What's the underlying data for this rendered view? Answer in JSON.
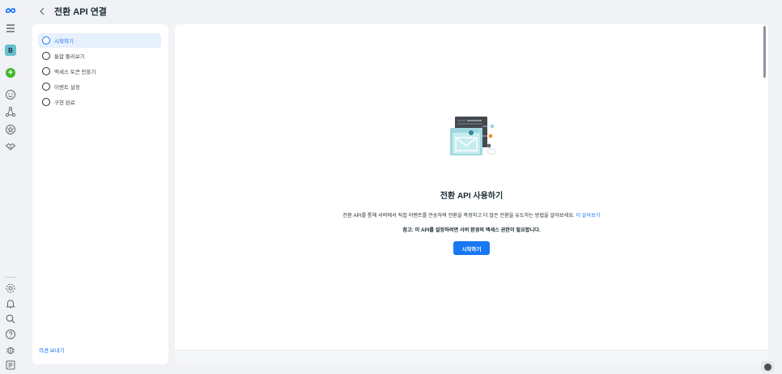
{
  "header": {
    "title": "전환 API 연결",
    "back_icon": "chevron-left-icon"
  },
  "rail": {
    "avatar_letter": "B",
    "icons": [
      "meta-logo-icon",
      "menu-icon",
      "create-plus-icon",
      "smiley-icon",
      "nodes-icon",
      "star-badge-icon",
      "handshake-icon",
      "settings-icon",
      "bell-icon",
      "search-icon",
      "help-icon",
      "bug-icon",
      "grid-icon"
    ]
  },
  "steps": {
    "items": [
      {
        "label": "시작하기",
        "active": true
      },
      {
        "label": "통합 둘러보기",
        "active": false
      },
      {
        "label": "액세스 토큰 만들기",
        "active": false
      },
      {
        "label": "이벤트 설정",
        "active": false
      },
      {
        "label": "구현 완료",
        "active": false
      }
    ],
    "feedback_label": "의견 보내기"
  },
  "main": {
    "heading": "전환 API 사용하기",
    "description": "전환 API를 통해 서버에서 직접 이벤트를 전송하여 전환을 측정하고 더 많은 전환을 유도하는 방법을 알아보세요.",
    "learn_more": "더 알아보기",
    "note": "참고: 이 API를 설정하려면 서버 환경의 액세스 권한이 필요합니다.",
    "start_button": "시작하기"
  },
  "colors": {
    "accent": "#1877f2",
    "background": "#f0f2f5",
    "active_step_bg": "#e7f0fd"
  }
}
